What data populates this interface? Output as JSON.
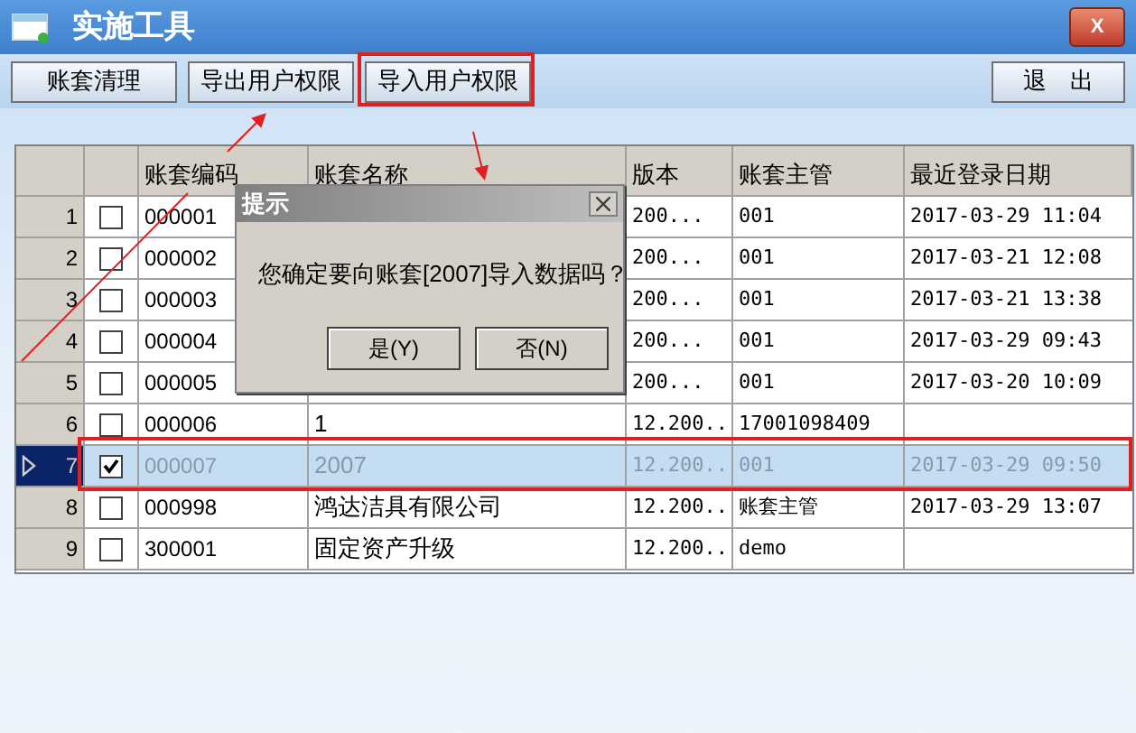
{
  "window": {
    "title": "实施工具",
    "close": "X"
  },
  "toolbar": {
    "buttons": [
      {
        "label": "账套清理"
      },
      {
        "label": "导出用户权限"
      },
      {
        "label": "导入用户权限"
      }
    ],
    "exit": "退　出"
  },
  "table": {
    "columns": [
      "账套编码",
      "账套名称",
      "版本",
      "账套主管",
      "最近登录日期"
    ],
    "rows": [
      {
        "index": "1",
        "checked": false,
        "selected": false,
        "code": "000001",
        "version": "200...",
        "manager": "001",
        "date": "2017-03-29 11:04"
      },
      {
        "index": "2",
        "checked": false,
        "selected": false,
        "code": "000002",
        "version": "200...",
        "manager": "001",
        "date": "2017-03-21 12:08"
      },
      {
        "index": "3",
        "checked": false,
        "selected": false,
        "code": "000003",
        "version": "200...",
        "manager": "001",
        "date": "2017-03-21 13:38"
      },
      {
        "index": "4",
        "checked": false,
        "selected": false,
        "code": "000004",
        "version": "200...",
        "manager": "001",
        "date": "2017-03-29 09:43"
      },
      {
        "index": "5",
        "checked": false,
        "selected": false,
        "code": "000005",
        "version": "200...",
        "manager": "001",
        "date": "2017-03-20 10:09"
      },
      {
        "index": "6",
        "checked": false,
        "selected": false,
        "code": "000006",
        "name": "1",
        "version": "12.200...",
        "manager": "17001098409"
      },
      {
        "index": "7",
        "checked": true,
        "selected": true,
        "code": "000007",
        "name": "2007",
        "version": "12.200...",
        "manager": "001",
        "date": "2017-03-29 09:50"
      },
      {
        "index": "8",
        "checked": false,
        "selected": false,
        "code": "000998",
        "name": "鸿达洁具有限公司",
        "version": "12.200...",
        "manager": "账套主管",
        "date": "2017-03-29 13:07"
      },
      {
        "index": "9",
        "checked": false,
        "selected": false,
        "code": "300001",
        "name": "固定资产升级",
        "version": "12.200...",
        "manager": "demo"
      }
    ]
  },
  "dialog": {
    "title": "提示",
    "message": "您确定要向账套[2007]导入数据吗？",
    "buttons": [
      "是(Y)",
      "否(N)"
    ]
  }
}
